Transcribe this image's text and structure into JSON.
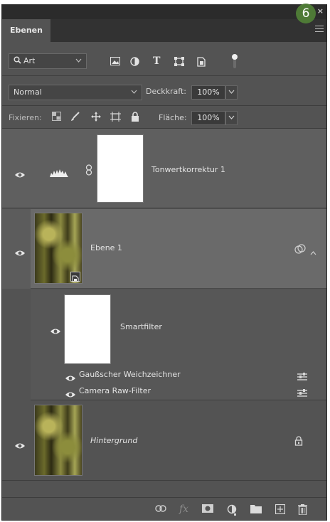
{
  "panel": {
    "tab_label": "Ebenen",
    "close_glyph": "×",
    "step_badge": "6"
  },
  "filter_bar": {
    "kind_label": "Art",
    "icons": [
      "pixel-layer-filter-icon",
      "adjustment-layer-filter-icon",
      "type-layer-filter-icon",
      "shape-layer-filter-icon",
      "smart-object-filter-icon",
      "filter-toggle-icon"
    ]
  },
  "blend_row": {
    "blend_mode": "Normal",
    "opacity_label": "Deckkraft:",
    "opacity_value": "100%"
  },
  "lock_row": {
    "lock_label": "Fixieren:",
    "fill_label": "Fläche:",
    "fill_value": "100%"
  },
  "layers": {
    "adjustment": {
      "name": "Tonwertkorrektur 1"
    },
    "smart": {
      "name": "Ebene 1"
    },
    "smartfilter": {
      "name": "Smartfilter",
      "filters": [
        "Gaußscher Weichzeichner",
        "Camera Raw-Filter"
      ]
    },
    "background": {
      "name": "Hintergrund"
    }
  },
  "bottom_icons": [
    "link-layers-icon",
    "fx-icon",
    "add-mask-icon",
    "new-adjustment-icon",
    "new-group-icon",
    "new-layer-icon",
    "delete-layer-icon"
  ],
  "colors": {
    "panel_bg": "#535353",
    "selected_row": "#6a6a6a",
    "badge": "#4e7a36"
  }
}
